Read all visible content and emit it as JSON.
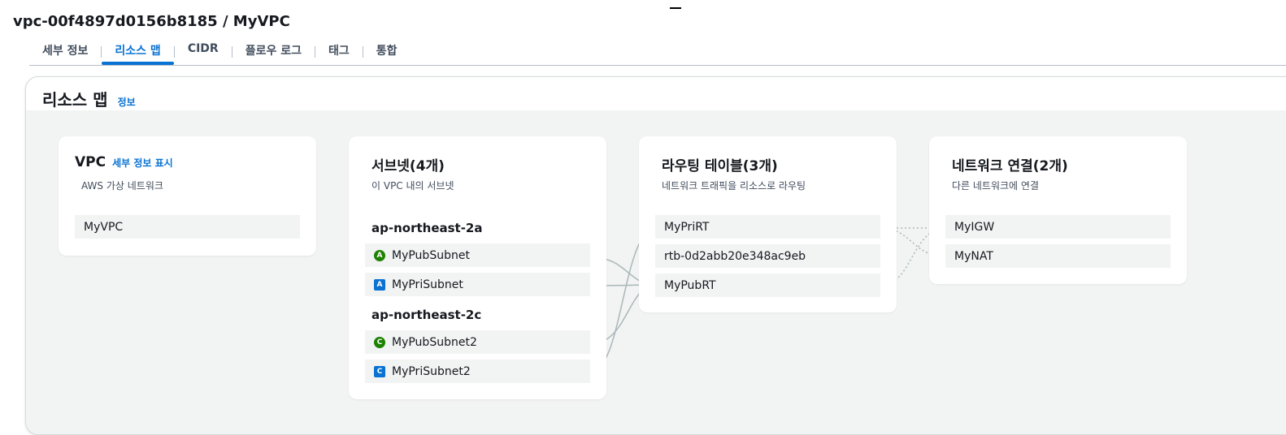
{
  "page": {
    "title": "vpc-00f4897d0156b8185 / MyVPC"
  },
  "tabs": [
    {
      "label": "세부 정보"
    },
    {
      "label": "리소스 맵"
    },
    {
      "label": "CIDR"
    },
    {
      "label": "플로우 로그"
    },
    {
      "label": "태그"
    },
    {
      "label": "통합"
    }
  ],
  "resource_map": {
    "title": "리소스 맵",
    "info_link": "정보",
    "vpc": {
      "title": "VPC",
      "details_link": "세부 정보 표시",
      "subtitle": "AWS 가상 네트워크",
      "name": "MyVPC"
    },
    "subnets": {
      "title": "서브넷(4개)",
      "subtitle": "이 VPC 내의 서브넷",
      "zones": [
        {
          "name": "ap-northeast-2a",
          "items": [
            {
              "badge": "A",
              "label": "MyPubSubnet"
            },
            {
              "badge": "A",
              "label": "MyPriSubnet"
            }
          ]
        },
        {
          "name": "ap-northeast-2c",
          "items": [
            {
              "badge": "C",
              "label": "MyPubSubnet2"
            },
            {
              "badge": "C",
              "label": "MyPriSubnet2"
            }
          ]
        }
      ]
    },
    "route_tables": {
      "title": "라우팅 테이블(3개)",
      "subtitle": "네트워크 트래픽을 리소스로 라우팅",
      "items": [
        {
          "label": "MyPriRT"
        },
        {
          "label": "rtb-0d2abb20e348ac9eb"
        },
        {
          "label": "MyPubRT"
        }
      ]
    },
    "network_connections": {
      "title": "네트워크 연결(2개)",
      "subtitle": "다른 네트워크에 연결",
      "items": [
        {
          "label": "MyIGW"
        },
        {
          "label": "MyNAT"
        }
      ]
    }
  },
  "colors": {
    "accent": "#0972d3",
    "public_badge": "#1d8102",
    "private_badge": "#0972d3",
    "connector": "#aab7b8"
  }
}
